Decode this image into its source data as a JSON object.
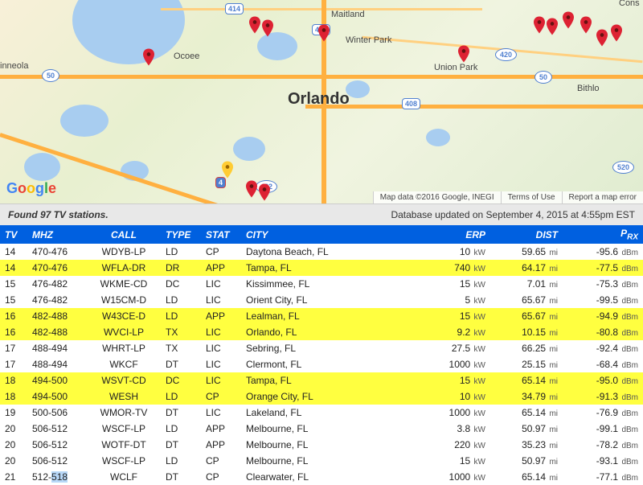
{
  "map": {
    "cities": {
      "orlando": "Orlando",
      "maitland": "Maitland",
      "winter_park": "Winter Park",
      "union_park": "Union Park",
      "ocoee": "Ocoee",
      "bithlo": "Bithlo",
      "minneola": "inneola",
      "conserv": "Cons"
    },
    "highways": {
      "h414": "414",
      "h441": "441",
      "h50a": "50",
      "h50b": "50",
      "h408": "408",
      "h420": "420",
      "h520": "520",
      "h482": "482",
      "h4": "4"
    },
    "attribution": "Map data ©2016 Google, INEGI",
    "terms": "Terms of Use",
    "report": "Report a map error",
    "logo": "Google"
  },
  "status": {
    "found": "Found 97 TV stations.",
    "updated": "Database updated on September 4, 2015 at 4:55pm EST"
  },
  "headers": {
    "tv": "TV",
    "mhz": "MHZ",
    "call": "CALL",
    "type": "TYPE",
    "stat": "STAT",
    "city": "CITY",
    "erp": "ERP",
    "dist": "DIST",
    "prx": "P",
    "prx_sub": "RX"
  },
  "units": {
    "kw": "kW",
    "mi": "mi",
    "dbm": "dBm"
  },
  "rows": [
    {
      "tv": "14",
      "mhz": "470-476",
      "call": "WDYB-LP",
      "type": "LD",
      "stat": "CP",
      "city": "Daytona Beach, FL",
      "erp": "10",
      "dist": "59.65",
      "prx": "-95.6",
      "hl": false
    },
    {
      "tv": "14",
      "mhz": "470-476",
      "call": "WFLA-DR",
      "type": "DR",
      "stat": "APP",
      "city": "Tampa, FL",
      "erp": "740",
      "dist": "64.17",
      "prx": "-77.5",
      "hl": true
    },
    {
      "tv": "15",
      "mhz": "476-482",
      "call": "WKME-CD",
      "type": "DC",
      "stat": "LIC",
      "city": "Kissimmee, FL",
      "erp": "15",
      "dist": "7.01",
      "prx": "-75.3",
      "hl": false
    },
    {
      "tv": "15",
      "mhz": "476-482",
      "call": "W15CM-D",
      "type": "LD",
      "stat": "LIC",
      "city": "Orient City, FL",
      "erp": "5",
      "dist": "65.67",
      "prx": "-99.5",
      "hl": false
    },
    {
      "tv": "16",
      "mhz": "482-488",
      "call": "W43CE-D",
      "type": "LD",
      "stat": "APP",
      "city": "Lealman, FL",
      "erp": "15",
      "dist": "65.67",
      "prx": "-94.9",
      "hl": true
    },
    {
      "tv": "16",
      "mhz": "482-488",
      "call": "WVCI-LP",
      "type": "TX",
      "stat": "LIC",
      "city": "Orlando, FL",
      "erp": "9.2",
      "dist": "10.15",
      "prx": "-80.8",
      "hl": true
    },
    {
      "tv": "17",
      "mhz": "488-494",
      "call": "WHRT-LP",
      "type": "TX",
      "stat": "LIC",
      "city": "Sebring, FL",
      "erp": "27.5",
      "dist": "66.25",
      "prx": "-92.4",
      "hl": false
    },
    {
      "tv": "17",
      "mhz": "488-494",
      "call": "WKCF",
      "type": "DT",
      "stat": "LIC",
      "city": "Clermont, FL",
      "erp": "1000",
      "dist": "25.15",
      "prx": "-68.4",
      "hl": false
    },
    {
      "tv": "18",
      "mhz": "494-500",
      "call": "WSVT-CD",
      "type": "DC",
      "stat": "LIC",
      "city": "Tampa, FL",
      "erp": "15",
      "dist": "65.14",
      "prx": "-95.0",
      "hl": true
    },
    {
      "tv": "18",
      "mhz": "494-500",
      "call": "WESH",
      "type": "LD",
      "stat": "CP",
      "city": "Orange City, FL",
      "erp": "10",
      "dist": "34.79",
      "prx": "-91.3",
      "hl": true
    },
    {
      "tv": "19",
      "mhz": "500-506",
      "call": "WMOR-TV",
      "type": "DT",
      "stat": "LIC",
      "city": "Lakeland, FL",
      "erp": "1000",
      "dist": "65.14",
      "prx": "-76.9",
      "hl": false
    },
    {
      "tv": "20",
      "mhz": "506-512",
      "call": "WSCF-LP",
      "type": "LD",
      "stat": "APP",
      "city": "Melbourne, FL",
      "erp": "3.8",
      "dist": "50.97",
      "prx": "-99.1",
      "hl": false
    },
    {
      "tv": "20",
      "mhz": "506-512",
      "call": "WOTF-DT",
      "type": "DT",
      "stat": "APP",
      "city": "Melbourne, FL",
      "erp": "220",
      "dist": "35.23",
      "prx": "-78.2",
      "hl": false
    },
    {
      "tv": "20",
      "mhz": "506-512",
      "call": "WSCF-LP",
      "type": "LD",
      "stat": "CP",
      "city": "Melbourne, FL",
      "erp": "15",
      "dist": "50.97",
      "prx": "-93.1",
      "hl": false
    },
    {
      "tv": "21",
      "mhz": "512-518",
      "call": "WCLF",
      "type": "DT",
      "stat": "CP",
      "city": "Clearwater, FL",
      "erp": "1000",
      "dist": "65.14",
      "prx": "-77.1",
      "hl": false,
      "sel": true
    }
  ]
}
